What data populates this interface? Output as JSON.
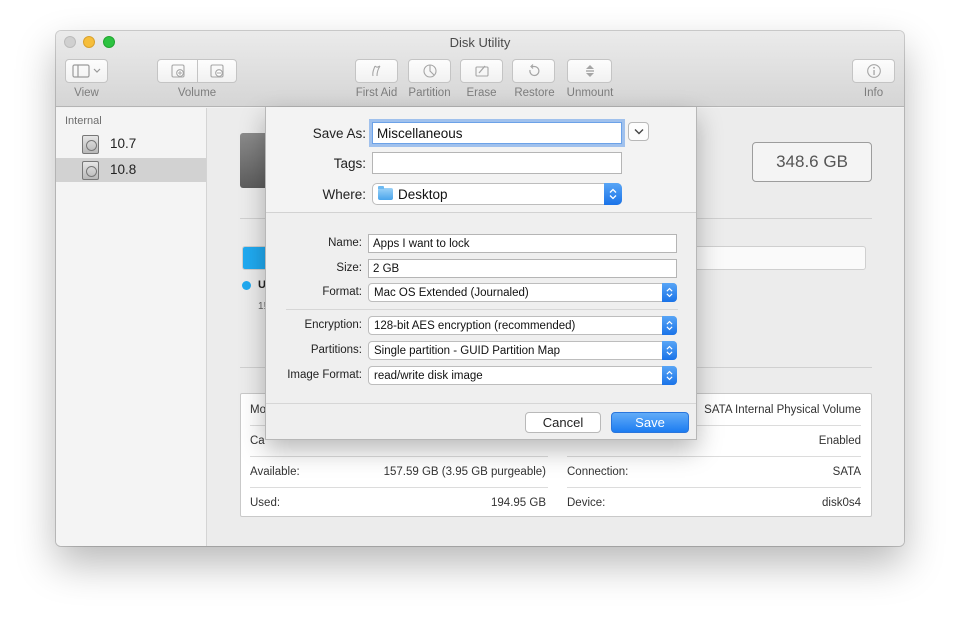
{
  "window": {
    "title": "Disk Utility"
  },
  "toolbar": {
    "view_label": "View",
    "volume_label": "Volume",
    "first_aid_label": "First Aid",
    "partition_label": "Partition",
    "erase_label": "Erase",
    "restore_label": "Restore",
    "unmount_label": "Unmount",
    "info_label": "Info",
    "icons": [
      "sidebar-toggle-icon",
      "add-volume-icon",
      "remove-volume-icon",
      "first-aid-icon",
      "partition-icon",
      "erase-icon",
      "restore-icon",
      "unmount-icon",
      "info-icon"
    ]
  },
  "sidebar": {
    "header": "Internal",
    "items": [
      {
        "label": "10.7",
        "selected": false
      },
      {
        "label": "10.8",
        "selected": true
      }
    ]
  },
  "main": {
    "capacity": "348.6 GB",
    "usage_fraction": 0.56,
    "usage_legend_initial": "U",
    "usage_legend_sub": "1!",
    "accent_color": "#20aaf1",
    "info": {
      "left_partial_labels": [
        "Mo",
        "Ca"
      ],
      "available_label": "Available:",
      "available_value": "157.59 GB (3.95 GB purgeable)",
      "used_label": "Used:",
      "used_value": "194.95 GB",
      "right": [
        {
          "value": "SATA Internal Physical Volume"
        },
        {
          "value": "Enabled"
        },
        {
          "label": "Connection:",
          "value": "SATA"
        },
        {
          "label": "Device:",
          "value": "disk0s4"
        }
      ]
    }
  },
  "save_sheet": {
    "save_as_label": "Save As:",
    "save_as_value": "Miscellaneous",
    "tags_label": "Tags:",
    "tags_value": "",
    "where_label": "Where:",
    "where_value": "Desktop",
    "name_label": "Name:",
    "name_value": "Apps I want to lock",
    "size_label": "Size:",
    "size_value": "2 GB",
    "format_label": "Format:",
    "format_value": "Mac OS Extended (Journaled)",
    "encryption_label": "Encryption:",
    "encryption_value": "128-bit AES encryption (recommended)",
    "partitions_label": "Partitions:",
    "partitions_value": "Single partition - GUID Partition Map",
    "image_format_label": "Image Format:",
    "image_format_value": "read/write disk image",
    "cancel_label": "Cancel",
    "save_label": "Save"
  }
}
